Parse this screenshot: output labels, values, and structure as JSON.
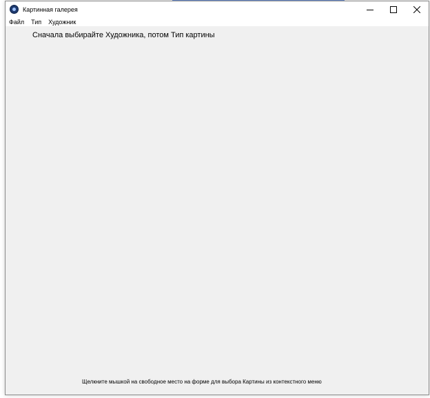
{
  "window": {
    "title": "Картинная галерея",
    "icon": "app-gallery-icon"
  },
  "controls": {
    "minimize": "minimize-icon",
    "maximize": "maximize-icon",
    "close": "close-icon"
  },
  "menu": {
    "items": [
      "Файл",
      "Тип",
      "Художник"
    ]
  },
  "main": {
    "instruction": "Сначала выбирайте Художника, потом Тип картины",
    "hint": "Щелкните мышкой на свободное место на форме для выбора Картины из контекстного меню"
  }
}
